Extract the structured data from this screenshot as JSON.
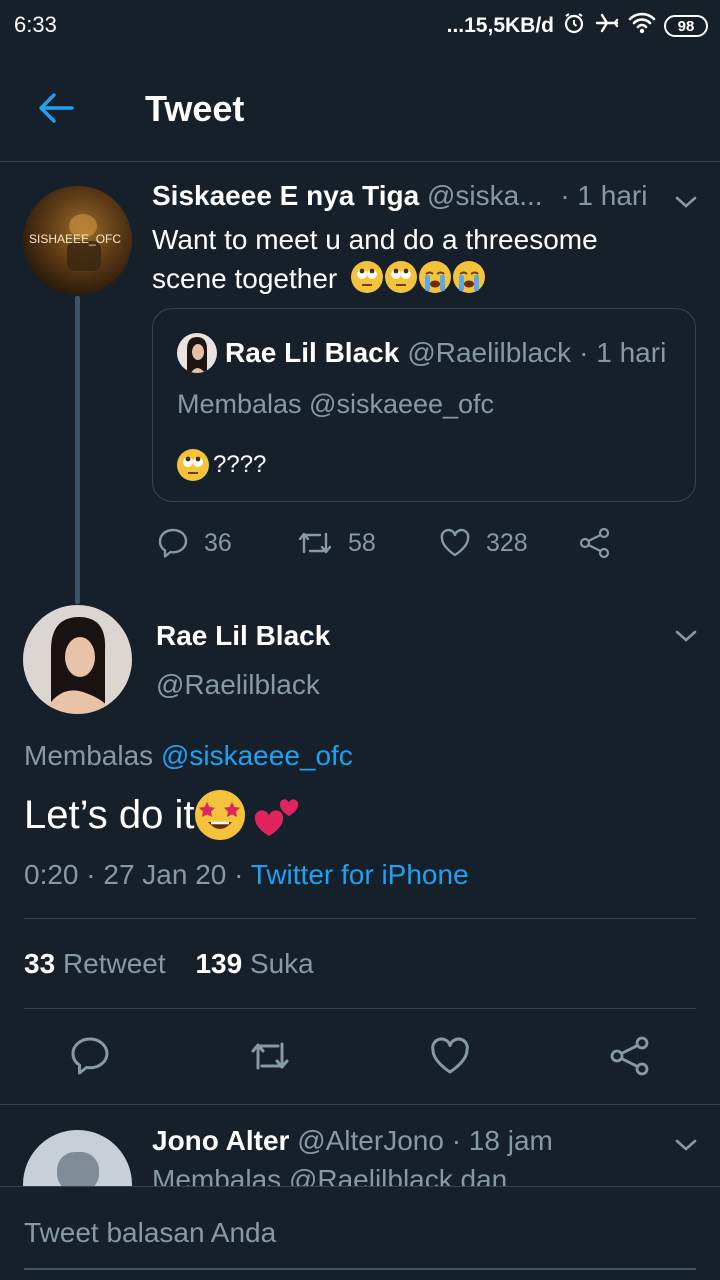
{
  "status_bar": {
    "time": "6:33",
    "network_speed": "...15,5KB/d",
    "battery": "98"
  },
  "header": {
    "title": "Tweet"
  },
  "thread_tweet": {
    "name": "Siskaeee E nya Tiga",
    "handle": "@siska...",
    "time": "· 1 hari",
    "avatar_text": "SISHAEEE_OFC",
    "text": "Want to meet u and do a threesome scene together",
    "quote": {
      "name": "Rae Lil Black",
      "handle": "@Raelilblack",
      "time": "· 1 hari",
      "reply_to_label": "Membalas @siskaeee_ofc",
      "text": "????"
    },
    "actions": {
      "replies": "36",
      "retweets": "58",
      "likes": "328"
    }
  },
  "main_tweet": {
    "name": "Rae Lil Black",
    "handle": "@Raelilblack",
    "reply_prefix": "Membalas",
    "reply_to": "@siskaeee_ofc",
    "text": "Let’s do it",
    "timestamp": "0:20 · 27 Jan 20 ·",
    "source": "Twitter for iPhone",
    "retweet_count": "33",
    "retweet_label": "Retweet",
    "like_count": "139",
    "like_label": "Suka"
  },
  "reply_preview": {
    "name": "Jono Alter",
    "handle": "@AlterJono",
    "time": "· 18 jam",
    "reply_line": "Membalas @Raelilblack dan"
  },
  "compose": {
    "placeholder": "Tweet balasan Anda"
  },
  "colors": {
    "background": "#15202b",
    "accent": "#1da1f2",
    "muted_text": "#8899a6",
    "divider": "#38444d"
  },
  "icons": [
    "back-arrow-icon",
    "chevron-down-icon",
    "reply-icon",
    "retweet-icon",
    "like-icon",
    "share-icon",
    "alarm-icon",
    "airplane-icon",
    "wifi-icon",
    "battery-icon"
  ]
}
